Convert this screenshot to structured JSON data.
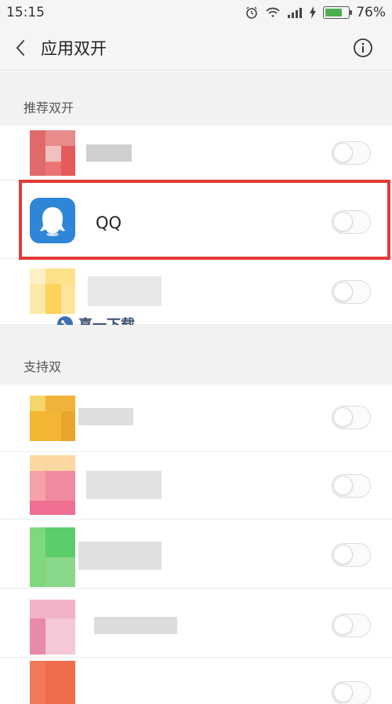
{
  "status_bar": {
    "time": "15:15",
    "battery": "76%",
    "battery_level": 0.76
  },
  "title_bar": {
    "title": "应用双开"
  },
  "sections": {
    "recommended": "推荐双开",
    "supported": "支持双"
  },
  "highlighted_app": {
    "name": "QQ",
    "enabled": false
  },
  "watermark": {
    "text": "喜一下载"
  },
  "colors": {
    "highlight": "#e53935",
    "battery": "#4caf50",
    "qq_icon": "#2f86d9"
  },
  "icons": [
    "back-icon",
    "info-icon",
    "wifi-icon",
    "alarm-icon",
    "signal-icon",
    "battery-icon",
    "qq-icon",
    "toggle-icon"
  ]
}
